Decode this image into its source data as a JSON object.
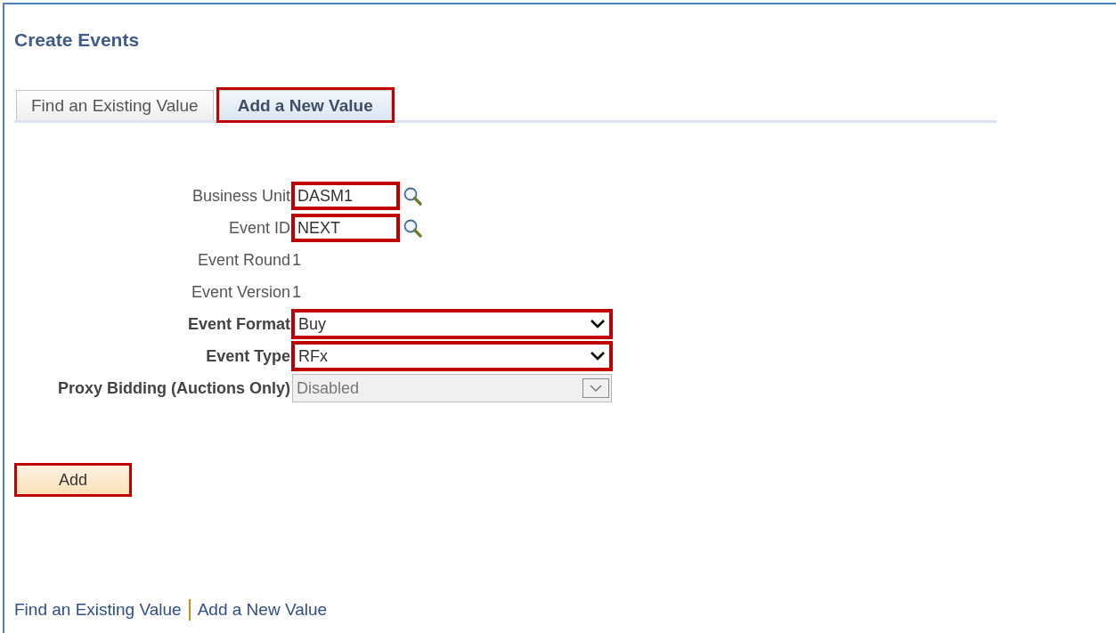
{
  "page_title": "Create Events",
  "tabs": [
    {
      "label": "Find an Existing Value",
      "selected": false,
      "highlighted": false
    },
    {
      "label": "Add a New Value",
      "selected": true,
      "highlighted": true
    }
  ],
  "fields": [
    {
      "kind": "lookup",
      "label": "Business Unit",
      "value": "DASM1",
      "bold": false,
      "highlighted": true
    },
    {
      "kind": "lookup",
      "label": "Event ID",
      "value": "NEXT",
      "bold": false,
      "highlighted": true
    },
    {
      "kind": "readonly",
      "label": "Event Round",
      "value": "1",
      "bold": false
    },
    {
      "kind": "readonly",
      "label": "Event Version",
      "value": "1",
      "bold": false
    },
    {
      "kind": "select",
      "label": "Event Format",
      "value": "Buy",
      "bold": true,
      "highlighted": true,
      "disabled": false
    },
    {
      "kind": "select",
      "label": "Event Type",
      "value": "RFx",
      "bold": true,
      "highlighted": true,
      "disabled": false
    },
    {
      "kind": "select",
      "label": "Proxy Bidding (Auctions Only)",
      "value": "Disabled",
      "bold": true,
      "highlighted": false,
      "disabled": true
    }
  ],
  "add_button": {
    "label": "Add",
    "highlighted": true
  },
  "footer_links": [
    "Find an Existing Value",
    "Add a New Value"
  ]
}
